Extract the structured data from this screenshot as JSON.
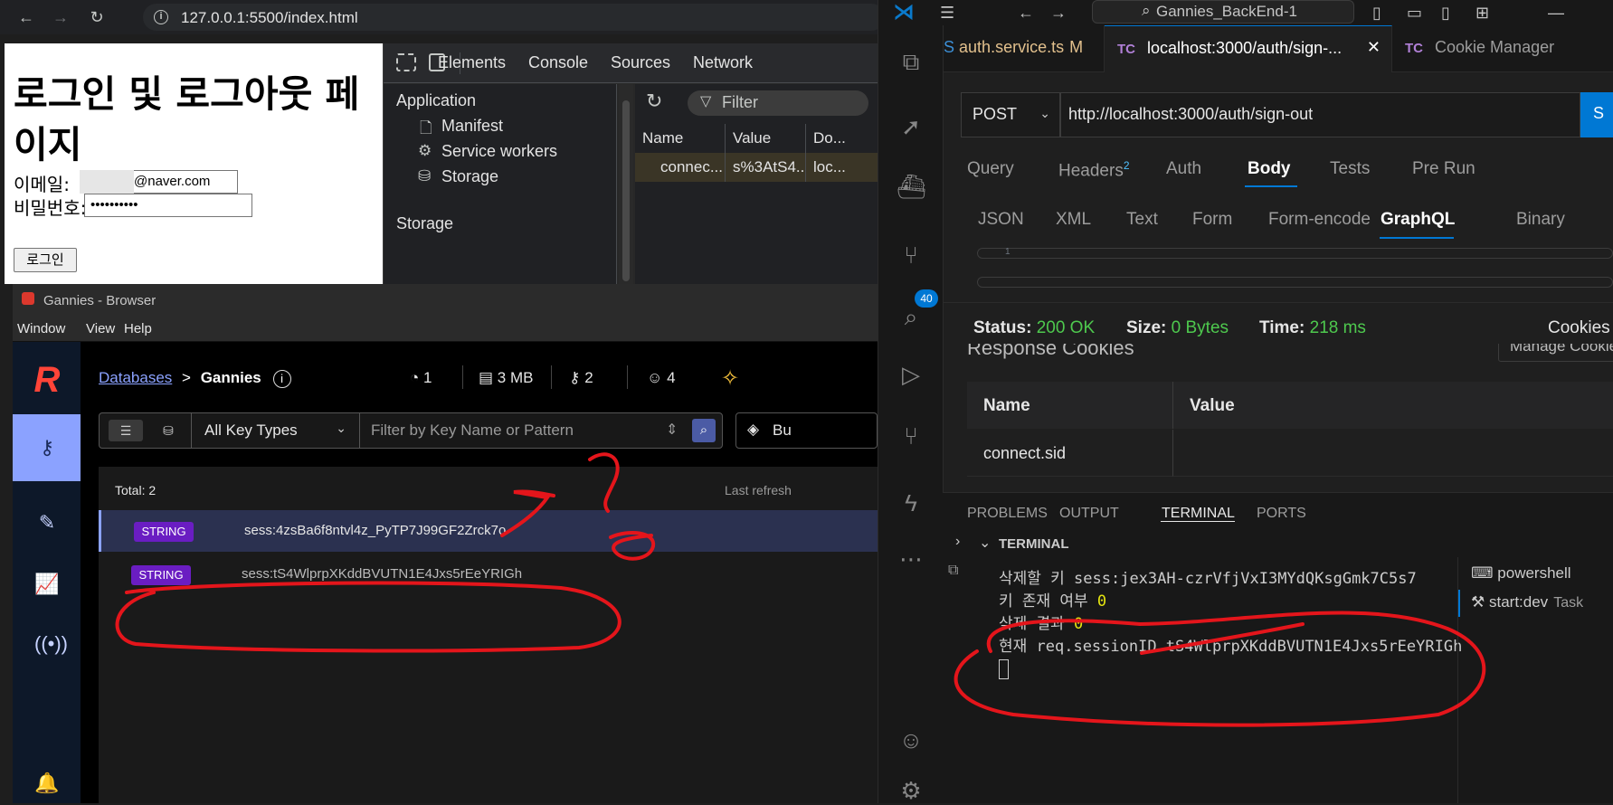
{
  "chrome": {
    "url": "127.0.0.1:5500/index.html",
    "page": {
      "title": "로그인 및 로그아웃 페이지",
      "email_label": "이메일:",
      "email_value": "@naver.com",
      "password_label": "비밀번호:",
      "password_value": "••••••••••",
      "login_button": "로그인"
    },
    "devtools": {
      "tabs": [
        "Elements",
        "Console",
        "Sources",
        "Network"
      ],
      "application_heading": "Application",
      "application_items": [
        "Manifest",
        "Service workers",
        "Storage"
      ],
      "storage_heading": "Storage",
      "filter_placeholder": "Filter",
      "columns": [
        "Name",
        "Value",
        "Do..."
      ],
      "row": [
        "connec...",
        "s%3AtS4...",
        "loc..."
      ]
    }
  },
  "redis": {
    "window_title": "Gannies - Browser",
    "menu": [
      "Window",
      "View",
      "Help"
    ],
    "breadcrumb_link": "Databases",
    "breadcrumb_sep": ">",
    "database": "Gannies",
    "stats": {
      "clients": "1",
      "memory": "3 MB",
      "keys": "2",
      "users": "4"
    },
    "key_type_select": "All Key Types",
    "filter_placeholder": "Filter by Key Name or Pattern",
    "bulk_label": "Bu",
    "total": "Total: 2",
    "last_refresh": "Last refresh",
    "rows": [
      {
        "type": "STRING",
        "key": "sess:4zsBa6f8ntvl4z_PyTP7J99GF2Zrck7o"
      },
      {
        "type": "STRING",
        "key": "sess:tS4WlprpXKddBVUTN1E4Jxs5rEeYRIGh"
      }
    ]
  },
  "vscode": {
    "search": "Gannies_BackEnd-1",
    "tabs": [
      {
        "label": "auth.service.ts",
        "badge": "M",
        "icon": "S"
      },
      {
        "label": "localhost:3000/auth/sign-...",
        "icon": "TC"
      },
      {
        "label": "Cookie Manager",
        "icon": "TC"
      }
    ],
    "activity_badge": "40",
    "request": {
      "method": "POST",
      "url": "http://localhost:3000/auth/sign-out",
      "send": "S",
      "tabs": [
        "Query",
        "Headers",
        "Auth",
        "Body",
        "Tests",
        "Pre Run"
      ],
      "headers_count": "2",
      "body_tabs": [
        "JSON",
        "XML",
        "Text",
        "Form",
        "Form-encode",
        "GraphQL",
        "Binary"
      ],
      "editor_line_no": "1"
    },
    "response": {
      "status_label": "Status:",
      "status_value": "200 OK",
      "size_label": "Size:",
      "size_value": "0 Bytes",
      "time_label": "Time:",
      "time_value": "218 ms",
      "cookies_tab": "Cookies",
      "section_title": "Response Cookies",
      "manage": "Manage Cookies",
      "columns": [
        "Name",
        "Value"
      ],
      "cookie_name": "connect.sid"
    },
    "panel": {
      "tabs": [
        "PROBLEMS",
        "OUTPUT",
        "TERMINAL",
        "PORTS"
      ],
      "terminal_title": "TERMINAL",
      "lines": {
        "l1": "삭제할 키 sess:jex3AH-czrVfjVxI3MYdQKsgGmk7C5s7",
        "l2": "키 존재 여부 ",
        "l2n": "0",
        "l3": "삭제 결과 ",
        "l3n": "0",
        "l4": "현재 req.sessionID tS4WlprpXKddBVUTN1E4Jxs5rEeYRIGh"
      },
      "terminals": [
        {
          "name": "powershell",
          "sub": ""
        },
        {
          "name": "start:dev",
          "sub": "Task"
        }
      ]
    }
  }
}
